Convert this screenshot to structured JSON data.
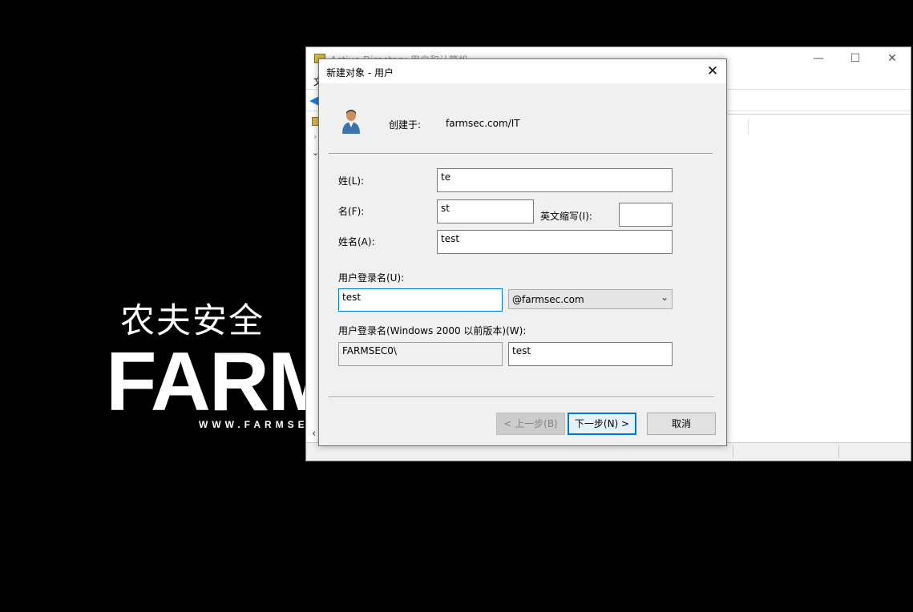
{
  "desktop": {
    "logo_cn": "农夫安全",
    "logo_main": "FARM",
    "logo_url": "WWW.FARMSEC"
  },
  "bg_window": {
    "title": "Active Directory 用户和计算机",
    "menu_first": "文",
    "minimize_glyph": "—",
    "maximize_glyph": "☐",
    "close_glyph": "✕"
  },
  "dialog": {
    "title": "新建对象 - 用户",
    "close_glyph": "✕",
    "created_in_label": "创建于:",
    "created_in_value": "farmsec.com/IT",
    "last_name_label": "姓(L):",
    "last_name_value": "te",
    "first_name_label": "名(F):",
    "first_name_value": "st",
    "initials_label": "英文缩写(I):",
    "initials_value": "",
    "full_name_label": "姓名(A):",
    "full_name_value": "test",
    "logon_name_label": "用户登录名(U):",
    "logon_name_value": "test",
    "domain_value": "@farmsec.com",
    "pre2000_label": "用户登录名(Windows 2000 以前版本)(W):",
    "pre2000_domain": "FARMSEC0\\",
    "pre2000_name": "test",
    "back_button": "< 上一步(B)",
    "next_button": "下一步(N) >",
    "cancel_button": "取消"
  },
  "colors": {
    "accent": "#0078d7",
    "dialog_bg": "#f0f0f0",
    "desktop_bg": "#000000"
  }
}
